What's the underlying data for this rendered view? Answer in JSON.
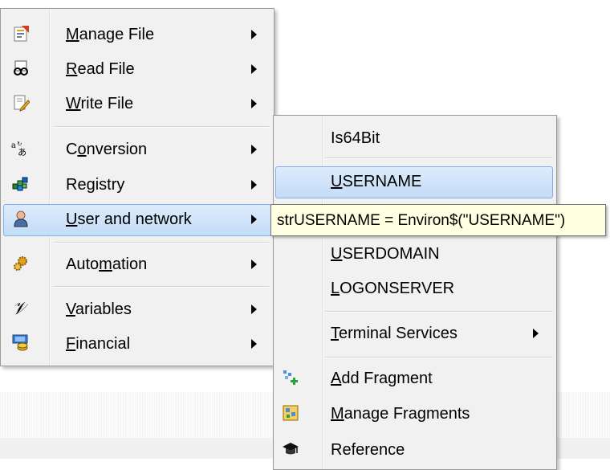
{
  "main_menu": {
    "items": [
      {
        "pre": "",
        "key": "M",
        "post": "anage File",
        "icon": "manage-file-icon",
        "submenu": true
      },
      {
        "pre": "",
        "key": "R",
        "post": "ead File",
        "icon": "read-file-icon",
        "submenu": true
      },
      {
        "pre": "",
        "key": "W",
        "post": "rite File",
        "icon": "write-file-icon",
        "submenu": true
      },
      {
        "pre": "C",
        "key": "o",
        "post": "nversion",
        "icon": "conversion-icon",
        "submenu": true
      },
      {
        "pre": "Re",
        "key": "g",
        "post": "istry",
        "icon": "registry-icon",
        "submenu": true
      },
      {
        "pre": "",
        "key": "U",
        "post": "ser and network",
        "icon": "user-network-icon",
        "submenu": true,
        "active": true
      },
      {
        "pre": "Auto",
        "key": "m",
        "post": "ation",
        "icon": "automation-icon",
        "submenu": true
      },
      {
        "pre": "",
        "key": "V",
        "post": "ariables",
        "icon": "variables-icon",
        "submenu": true
      },
      {
        "pre": "",
        "key": "F",
        "post": "inancial",
        "icon": "financial-icon",
        "submenu": true
      }
    ]
  },
  "sub_menu": {
    "items": [
      {
        "pre": "",
        "key": "",
        "post": "Is64Bit"
      },
      {
        "pre": "",
        "key": "U",
        "post": "SERNAME",
        "active": true
      },
      {
        "pre": "",
        "key": "U",
        "post": "SERDOMAIN"
      },
      {
        "pre": "",
        "key": "L",
        "post": "OGONSERVER"
      },
      {
        "pre": "",
        "key": "T",
        "post": "erminal Services",
        "submenu": true
      },
      {
        "pre": "",
        "key": "A",
        "post": "dd Fragment",
        "icon": "add-fragment-icon"
      },
      {
        "pre": "",
        "key": "M",
        "post": "anage Fragments",
        "icon": "manage-fragments-icon"
      },
      {
        "pre": "",
        "key": "",
        "post": "Reference",
        "icon": "reference-icon"
      }
    ]
  },
  "tooltip": {
    "text": "strUSERNAME = Environ$(\"USERNAME\")"
  },
  "colors": {
    "highlight_border": "#7fb0e8",
    "tooltip_bg": "#ffffe1",
    "menu_bg": "#f1f1f1"
  }
}
